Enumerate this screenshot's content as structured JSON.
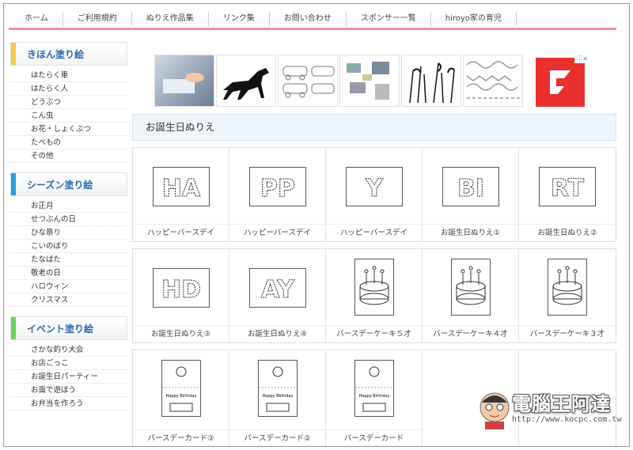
{
  "nav": {
    "items": [
      "ホーム",
      "ご利用規約",
      "ぬりえ作品集",
      "リンク集",
      "お問い合わせ",
      "スポンサー一覧",
      "hiroyo家の育児"
    ]
  },
  "sidebar": {
    "sections": [
      {
        "title": "きほん塗り絵",
        "color": "#f2c94c",
        "items": [
          "はたらく車",
          "はたらく人",
          "どうぶつ",
          "こん虫",
          "お花・しょくぶつ",
          "たべもの",
          "その他"
        ]
      },
      {
        "title": "シーズン塗り絵",
        "color": "#2d9cdb",
        "items": [
          "お正月",
          "せつぶんの日",
          "ひな祭り",
          "こいのぼり",
          "たなばた",
          "敬老の日",
          "ハロウィン",
          "クリスマス"
        ]
      },
      {
        "title": "イベント塗り絵",
        "color": "#6fcf5f",
        "items": [
          "さかな釣り大会",
          "お店ごっこ",
          "お誕生日パーティー",
          "お面で遊ぼう",
          "お弁当を作ろう"
        ]
      }
    ]
  },
  "ads": {
    "choice_label": "ⓘ✕"
  },
  "page_title": "お誕生日ぬりえ",
  "grid": {
    "rows": [
      [
        "ハッピーバースデイ",
        "ハッピーバースデイ",
        "ハッピーバースデイ",
        "お誕生日ぬりえ①",
        "お誕生日ぬりえ②"
      ],
      [
        "お誕生日ぬりえ③",
        "お誕生日ぬりえ④",
        "バースデーケーキ５才",
        "バースデーケーキ４才",
        "バースデーケーキ３才"
      ],
      [
        "バースデーカード③",
        "バースデーカード②",
        "バースデーカード",
        "",
        ""
      ]
    ],
    "thumb_letters": [
      [
        "HA",
        "PP",
        "Y",
        "BI",
        "RT"
      ],
      [
        "HD",
        "AY",
        "",
        "",
        ""
      ],
      [
        "",
        "",
        "",
        "",
        ""
      ]
    ],
    "card_text": "Happy Birthday"
  },
  "watermark": {
    "title": "電腦王阿達",
    "url": "http://www.kocpc.com.tw"
  }
}
